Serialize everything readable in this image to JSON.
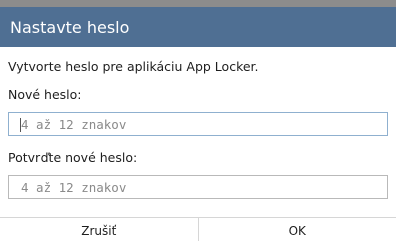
{
  "dialog": {
    "title": "Nastavte heslo",
    "message": "Vytvorte heslo pre aplikáciu App Locker.",
    "new_password": {
      "label": "Nové heslo:",
      "placeholder": "4 až 12 znakov",
      "value": ""
    },
    "confirm_password": {
      "label": "Potvrďte nové heslo:",
      "placeholder": "4 až 12 znakov",
      "value": ""
    },
    "buttons": {
      "cancel": "Zrušiť",
      "ok": "OK"
    }
  },
  "colors": {
    "title_bar": "#4f6f93",
    "title_text": "#ffffff",
    "focused_field_border": "#8fb0cf"
  }
}
